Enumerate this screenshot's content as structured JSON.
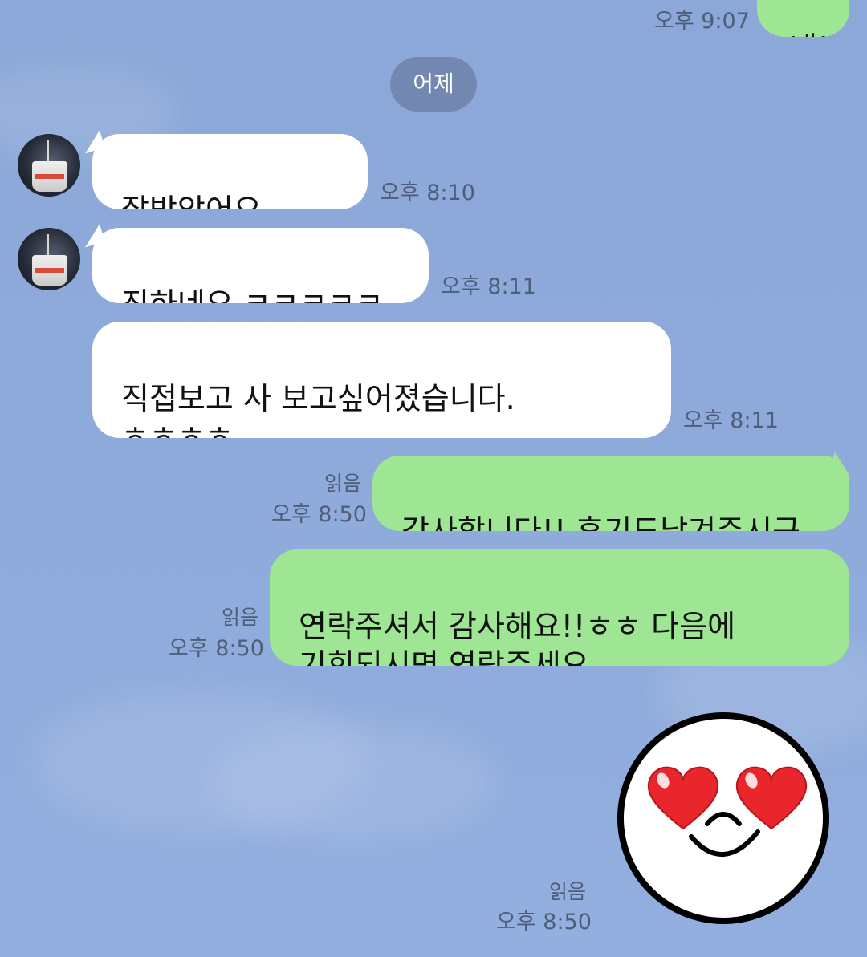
{
  "date_divider": "어제",
  "partial_top": {
    "time": "오후 9:07",
    "text": "네!"
  },
  "messages": [
    {
      "sender": "other",
      "text": "잘받았어요~~~",
      "time": "오후 8:10",
      "avatar": true
    },
    {
      "sender": "other",
      "text": "진하네요.ㅋㅋㅋㅋㅋ",
      "time": "오후 8:11",
      "avatar": true
    },
    {
      "sender": "other",
      "text": "직접보고 사 보고싶어졌습니다.\nㅎㅎㅎㅎ",
      "time": "오후 8:11",
      "avatar": false
    },
    {
      "sender": "me",
      "text": "감사합니다!! 후기도남겨주시구",
      "time": "오후 8:50",
      "read": "읽음"
    },
    {
      "sender": "me",
      "text": "연락주셔서 감사해요!!ㅎㅎ 다음에\n기회되시면 연락주세요",
      "time": "오후 8:50",
      "read": "읽음"
    },
    {
      "sender": "me",
      "type": "sticker",
      "sticker": "heart-eyes-face",
      "time": "오후 8:50",
      "read": "읽음"
    }
  ],
  "colors": {
    "background": "#8eaadb",
    "incoming_bubble": "#ffffff",
    "outgoing_bubble": "#9ee693",
    "date_chip": "#7388b0",
    "meta_text": "#4f5e78"
  }
}
